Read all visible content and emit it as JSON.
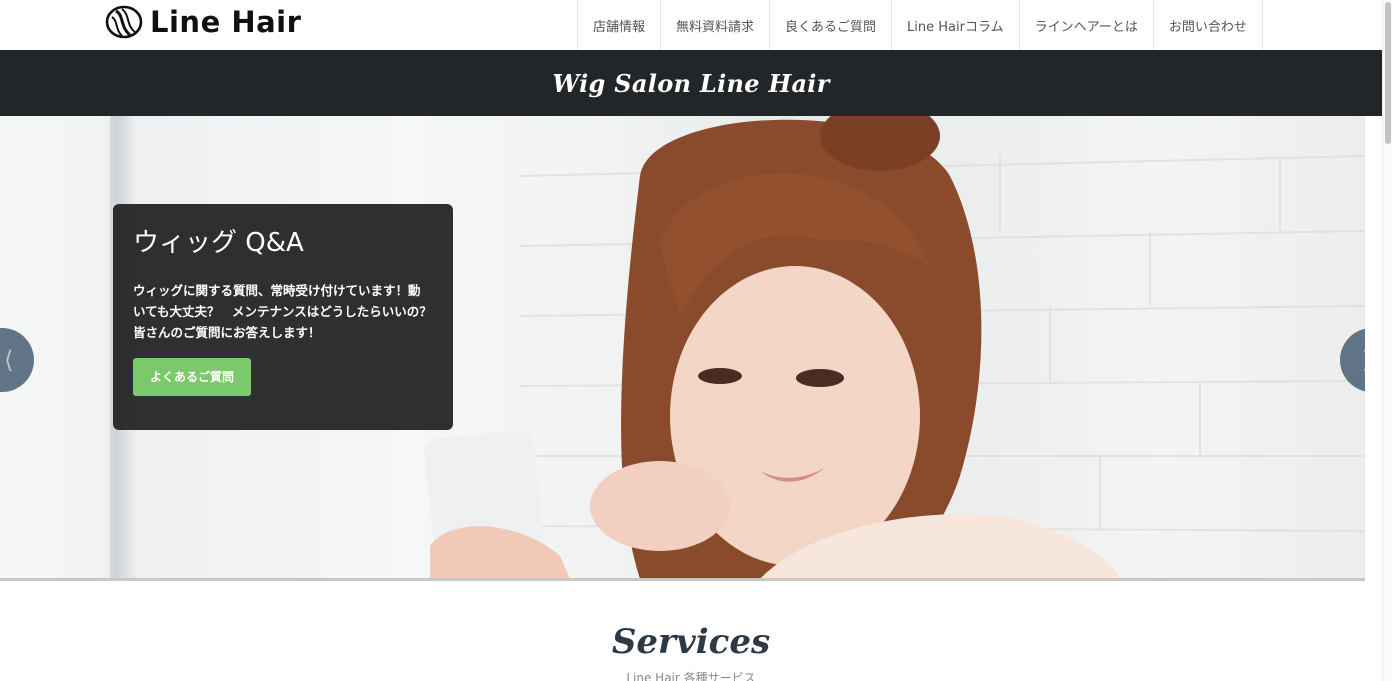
{
  "header": {
    "logo_text": "Line Hair",
    "nav": [
      {
        "label": "店舗情報"
      },
      {
        "label": "無料資料請求"
      },
      {
        "label": "良くあるご質問"
      },
      {
        "label": "Line Hairコラム"
      },
      {
        "label": "ラインヘアーとは"
      },
      {
        "label": "お問い合わせ"
      }
    ]
  },
  "title_bar": {
    "title": "Wig Salon Line Hair"
  },
  "hero": {
    "caption_title": "ウィッグ Q&A",
    "caption_text": "ウィッグに関する質問、常時受け付けています！動いても大丈夫？　メンテナンスはどうしたらいいの？　皆さんのご質問にお答えします！",
    "button_label": "よくあるご質問",
    "prev_icon": "chevron-left-icon",
    "next_icon": "chevron-right-icon"
  },
  "services": {
    "title": "Services",
    "subtitle": "Line Hair 各種サービス"
  },
  "colors": {
    "title_bar_bg": "#222628",
    "caption_bg": "#222426",
    "button_green": "#7bc96b",
    "arrow_bg": "#465e72",
    "services_title": "#2d3a46"
  }
}
